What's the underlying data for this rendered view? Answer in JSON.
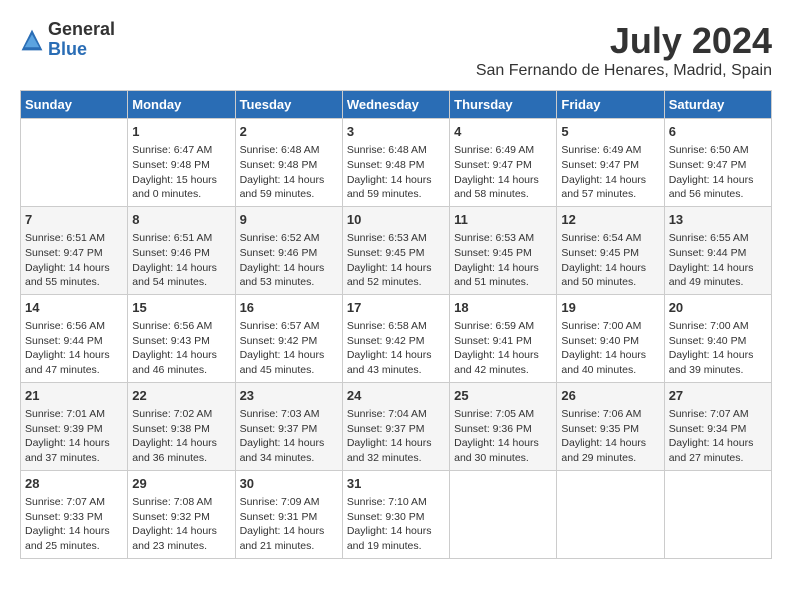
{
  "logo": {
    "general": "General",
    "blue": "Blue"
  },
  "title": "July 2024",
  "subtitle": "San Fernando de Henares, Madrid, Spain",
  "days_of_week": [
    "Sunday",
    "Monday",
    "Tuesday",
    "Wednesday",
    "Thursday",
    "Friday",
    "Saturday"
  ],
  "weeks": [
    [
      {
        "day": "",
        "info": ""
      },
      {
        "day": "1",
        "info": "Sunrise: 6:47 AM\nSunset: 9:48 PM\nDaylight: 15 hours\nand 0 minutes."
      },
      {
        "day": "2",
        "info": "Sunrise: 6:48 AM\nSunset: 9:48 PM\nDaylight: 14 hours\nand 59 minutes."
      },
      {
        "day": "3",
        "info": "Sunrise: 6:48 AM\nSunset: 9:48 PM\nDaylight: 14 hours\nand 59 minutes."
      },
      {
        "day": "4",
        "info": "Sunrise: 6:49 AM\nSunset: 9:47 PM\nDaylight: 14 hours\nand 58 minutes."
      },
      {
        "day": "5",
        "info": "Sunrise: 6:49 AM\nSunset: 9:47 PM\nDaylight: 14 hours\nand 57 minutes."
      },
      {
        "day": "6",
        "info": "Sunrise: 6:50 AM\nSunset: 9:47 PM\nDaylight: 14 hours\nand 56 minutes."
      }
    ],
    [
      {
        "day": "7",
        "info": "Sunrise: 6:51 AM\nSunset: 9:47 PM\nDaylight: 14 hours\nand 55 minutes."
      },
      {
        "day": "8",
        "info": "Sunrise: 6:51 AM\nSunset: 9:46 PM\nDaylight: 14 hours\nand 54 minutes."
      },
      {
        "day": "9",
        "info": "Sunrise: 6:52 AM\nSunset: 9:46 PM\nDaylight: 14 hours\nand 53 minutes."
      },
      {
        "day": "10",
        "info": "Sunrise: 6:53 AM\nSunset: 9:45 PM\nDaylight: 14 hours\nand 52 minutes."
      },
      {
        "day": "11",
        "info": "Sunrise: 6:53 AM\nSunset: 9:45 PM\nDaylight: 14 hours\nand 51 minutes."
      },
      {
        "day": "12",
        "info": "Sunrise: 6:54 AM\nSunset: 9:45 PM\nDaylight: 14 hours\nand 50 minutes."
      },
      {
        "day": "13",
        "info": "Sunrise: 6:55 AM\nSunset: 9:44 PM\nDaylight: 14 hours\nand 49 minutes."
      }
    ],
    [
      {
        "day": "14",
        "info": "Sunrise: 6:56 AM\nSunset: 9:44 PM\nDaylight: 14 hours\nand 47 minutes."
      },
      {
        "day": "15",
        "info": "Sunrise: 6:56 AM\nSunset: 9:43 PM\nDaylight: 14 hours\nand 46 minutes."
      },
      {
        "day": "16",
        "info": "Sunrise: 6:57 AM\nSunset: 9:42 PM\nDaylight: 14 hours\nand 45 minutes."
      },
      {
        "day": "17",
        "info": "Sunrise: 6:58 AM\nSunset: 9:42 PM\nDaylight: 14 hours\nand 43 minutes."
      },
      {
        "day": "18",
        "info": "Sunrise: 6:59 AM\nSunset: 9:41 PM\nDaylight: 14 hours\nand 42 minutes."
      },
      {
        "day": "19",
        "info": "Sunrise: 7:00 AM\nSunset: 9:40 PM\nDaylight: 14 hours\nand 40 minutes."
      },
      {
        "day": "20",
        "info": "Sunrise: 7:00 AM\nSunset: 9:40 PM\nDaylight: 14 hours\nand 39 minutes."
      }
    ],
    [
      {
        "day": "21",
        "info": "Sunrise: 7:01 AM\nSunset: 9:39 PM\nDaylight: 14 hours\nand 37 minutes."
      },
      {
        "day": "22",
        "info": "Sunrise: 7:02 AM\nSunset: 9:38 PM\nDaylight: 14 hours\nand 36 minutes."
      },
      {
        "day": "23",
        "info": "Sunrise: 7:03 AM\nSunset: 9:37 PM\nDaylight: 14 hours\nand 34 minutes."
      },
      {
        "day": "24",
        "info": "Sunrise: 7:04 AM\nSunset: 9:37 PM\nDaylight: 14 hours\nand 32 minutes."
      },
      {
        "day": "25",
        "info": "Sunrise: 7:05 AM\nSunset: 9:36 PM\nDaylight: 14 hours\nand 30 minutes."
      },
      {
        "day": "26",
        "info": "Sunrise: 7:06 AM\nSunset: 9:35 PM\nDaylight: 14 hours\nand 29 minutes."
      },
      {
        "day": "27",
        "info": "Sunrise: 7:07 AM\nSunset: 9:34 PM\nDaylight: 14 hours\nand 27 minutes."
      }
    ],
    [
      {
        "day": "28",
        "info": "Sunrise: 7:07 AM\nSunset: 9:33 PM\nDaylight: 14 hours\nand 25 minutes."
      },
      {
        "day": "29",
        "info": "Sunrise: 7:08 AM\nSunset: 9:32 PM\nDaylight: 14 hours\nand 23 minutes."
      },
      {
        "day": "30",
        "info": "Sunrise: 7:09 AM\nSunset: 9:31 PM\nDaylight: 14 hours\nand 21 minutes."
      },
      {
        "day": "31",
        "info": "Sunrise: 7:10 AM\nSunset: 9:30 PM\nDaylight: 14 hours\nand 19 minutes."
      },
      {
        "day": "",
        "info": ""
      },
      {
        "day": "",
        "info": ""
      },
      {
        "day": "",
        "info": ""
      }
    ]
  ]
}
